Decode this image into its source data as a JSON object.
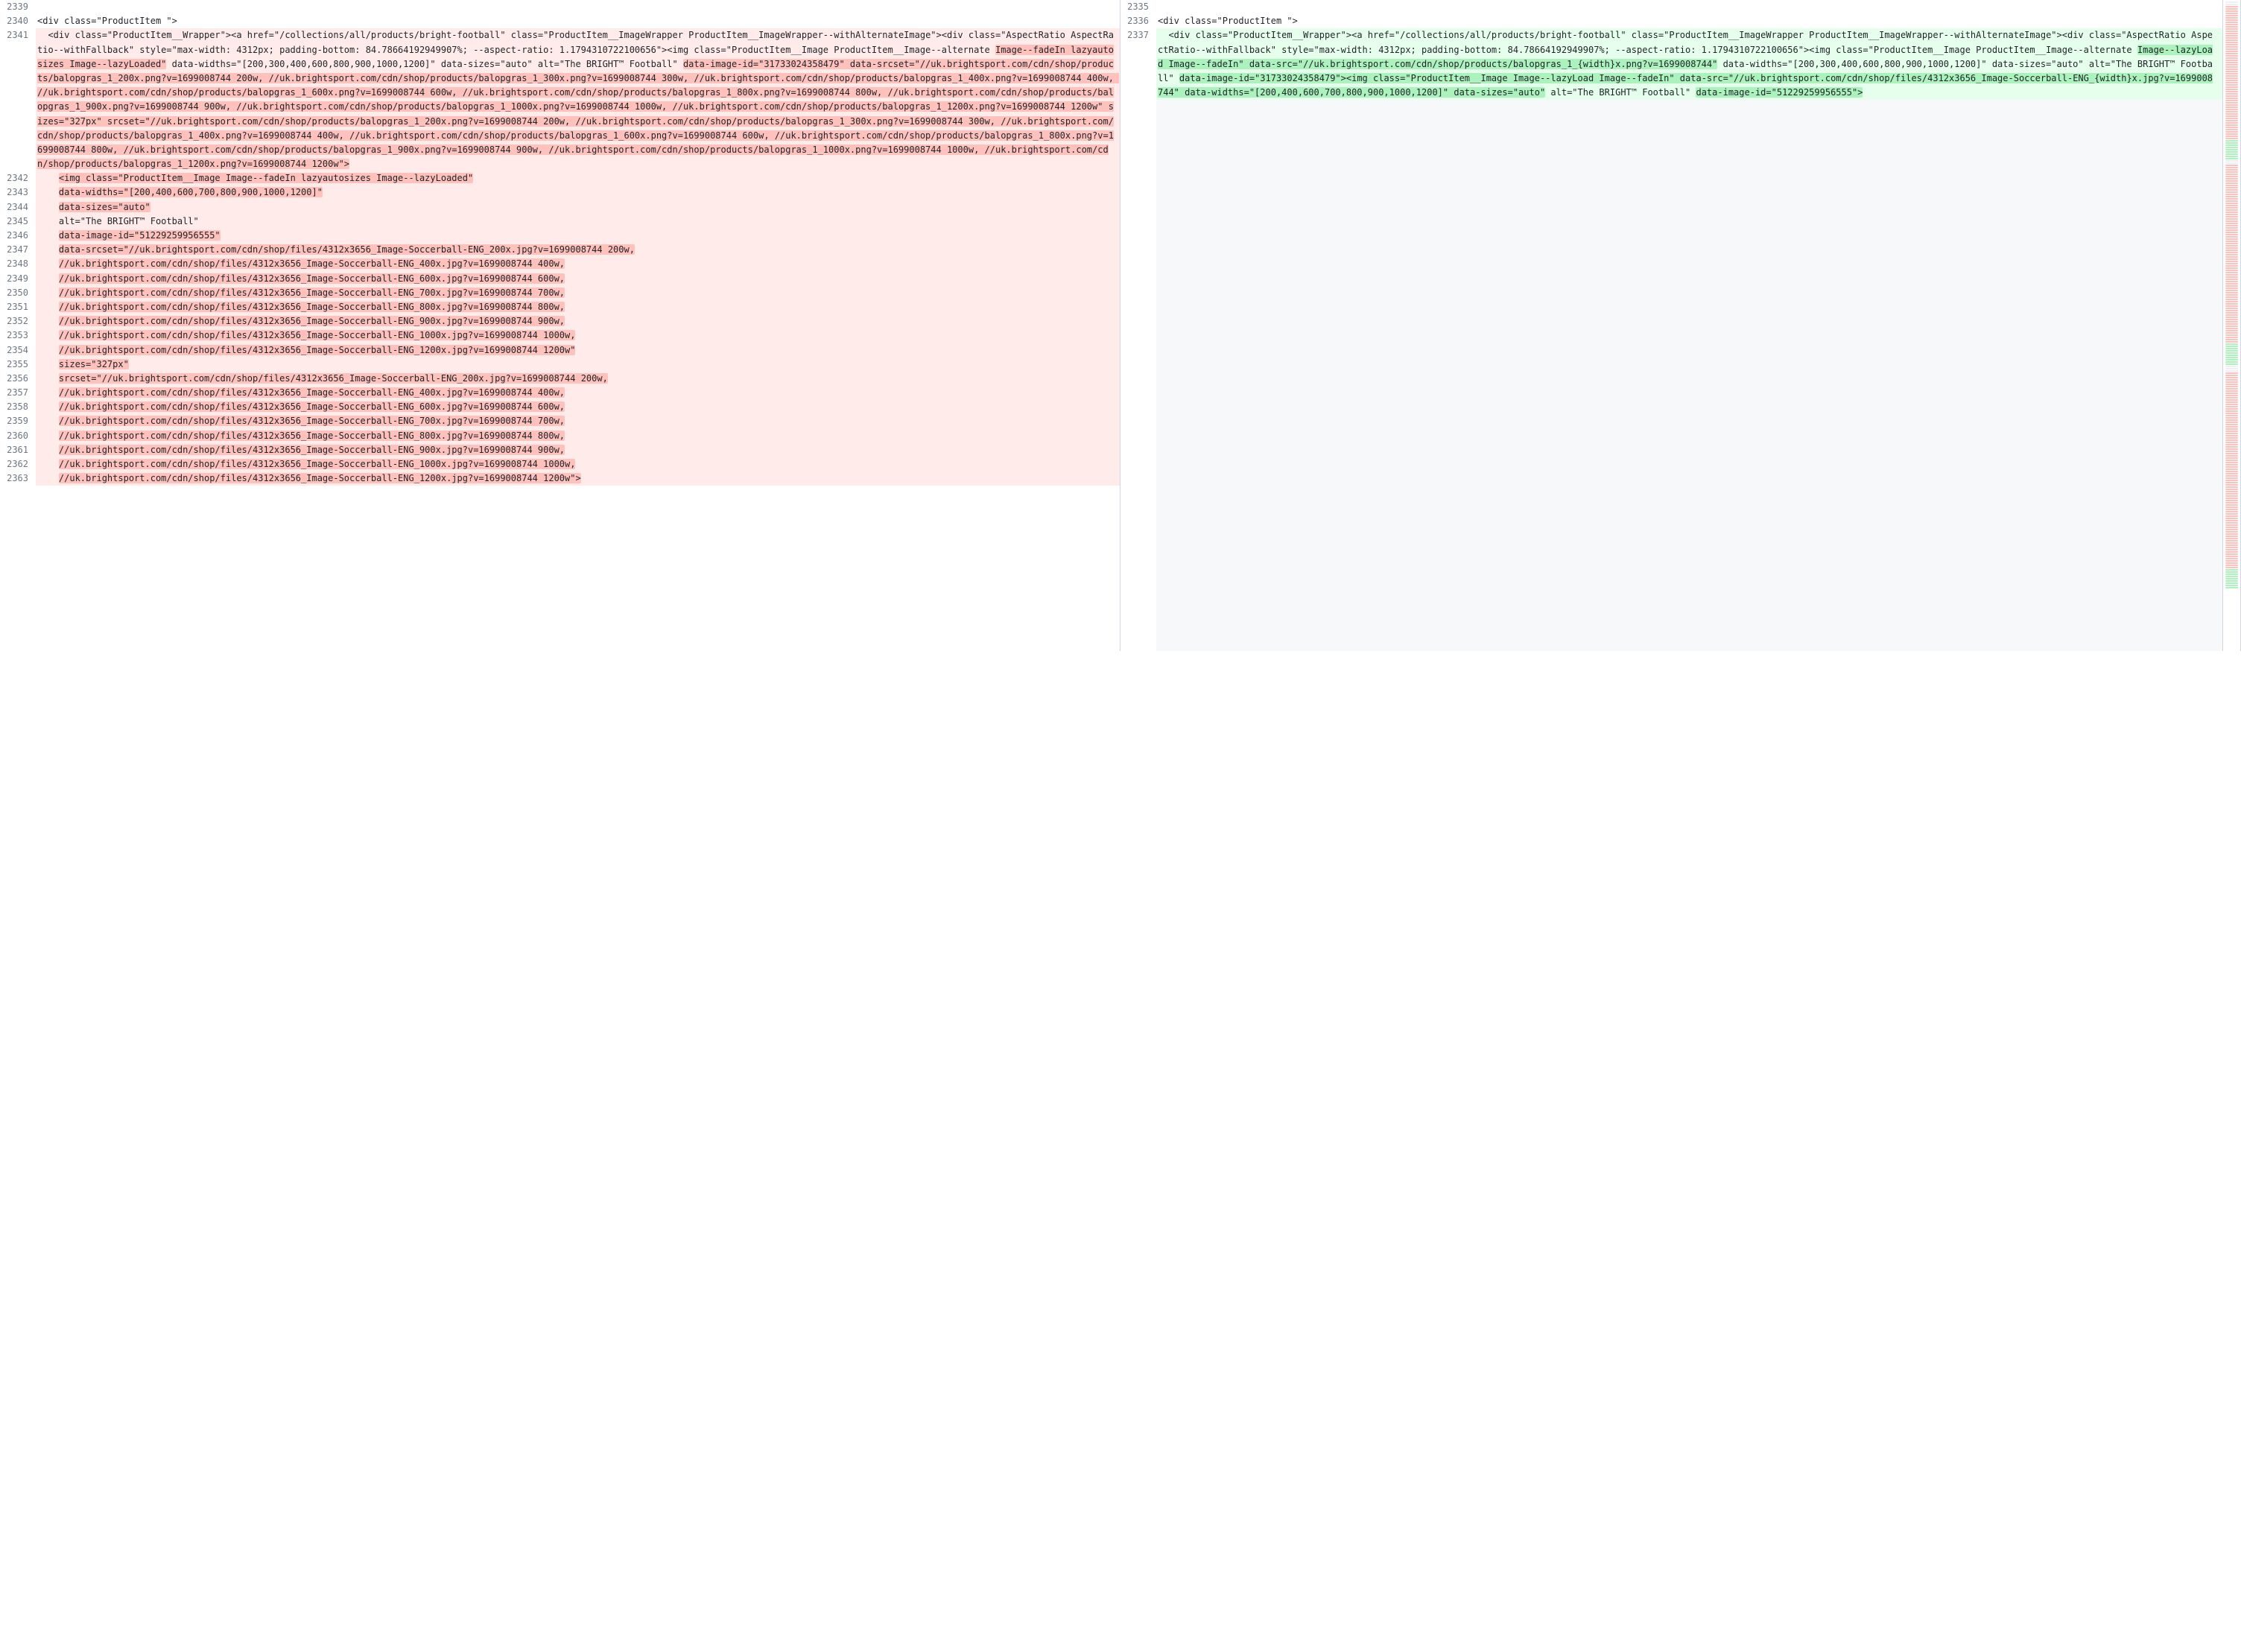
{
  "left": [
    {
      "n": "2339",
      "kind": "ctx",
      "segs": [
        {
          "t": ""
        }
      ]
    },
    {
      "n": "2340",
      "kind": "ctx",
      "segs": [
        {
          "t": "<div class=\"ProductItem \">"
        }
      ]
    },
    {
      "n": "2341",
      "kind": "del",
      "segs": [
        {
          "t": "  <div class=\"ProductItem__Wrapper\"><a href=\"/collections/all/products/bright-football\" class=\"ProductItem__ImageWrapper ProductItem__ImageWrapper--withAlternateImage\"><div class=\"AspectRatio AspectRatio--withFallback\" style=\"max-width: 4312px; padding-bottom: 84.78664192949907%; --aspect-ratio: 1.1794310722100656\"><img class=\"ProductItem__Image ProductItem__Image--alternate "
        },
        {
          "t": "Image--fadeIn lazyautosizes Image--lazyLoaded\"",
          "h": true
        },
        {
          "t": " data-widths=\"[200,300,400,600,800,900,1000,1200]\" data-sizes=\"auto\" alt=\"The BRIGHT™ Football\" "
        },
        {
          "t": "data-image-id=\"31733024358479\" data-srcset=\"//uk.brightsport.com/cdn/shop/products/balopgras_1_200x.png?v=1699008744 200w, //uk.brightsport.com/cdn/shop/products/balopgras_1_300x.png?v=1699008744 300w, //uk.brightsport.com/cdn/shop/products/balopgras_1_400x.png?v=1699008744 400w, //uk.brightsport.com/cdn/shop/products/balopgras_1_600x.png?v=1699008744 600w, //uk.brightsport.com/cdn/shop/products/balopgras_1_800x.png?v=1699008744 800w, //uk.brightsport.com/cdn/shop/products/balopgras_1_900x.png?v=1699008744 900w, //uk.brightsport.com/cdn/shop/products/balopgras_1_1000x.png?v=1699008744 1000w, //uk.brightsport.com/cdn/shop/products/balopgras_1_1200x.png?v=1699008744 1200w\" sizes=\"327px\" srcset=\"//uk.brightsport.com/cdn/shop/products/balopgras_1_200x.png?v=1699008744 200w, //uk.brightsport.com/cdn/shop/products/balopgras_1_300x.png?v=1699008744 300w, //uk.brightsport.com/cdn/shop/products/balopgras_1_400x.png?v=1699008744 400w, //uk.brightsport.com/cdn/shop/products/balopgras_1_600x.png?v=1699008744 600w, //uk.brightsport.com/cdn/shop/products/balopgras_1_800x.png?v=1699008744 800w, //uk.brightsport.com/cdn/shop/products/balopgras_1_900x.png?v=1699008744 900w, //uk.brightsport.com/cdn/shop/products/balopgras_1_1000x.png?v=1699008744 1000w, //uk.brightsport.com/cdn/shop/products/balopgras_1_1200x.png?v=1699008744 1200w\">",
          "h": true
        }
      ]
    },
    {
      "n": "2342",
      "kind": "del",
      "segs": [
        {
          "t": "    "
        },
        {
          "t": "<img class=\"ProductItem__Image Image--fadeIn lazyautosizes Image--lazyLoaded\"",
          "h": true
        }
      ]
    },
    {
      "n": "2343",
      "kind": "del",
      "segs": [
        {
          "t": "    "
        },
        {
          "t": "data-widths=\"[200,400,600,700,800,900,1000,1200]\"",
          "h": true
        }
      ]
    },
    {
      "n": "2344",
      "kind": "del",
      "segs": [
        {
          "t": "    "
        },
        {
          "t": "data-sizes=\"auto\"",
          "h": true
        }
      ]
    },
    {
      "n": "2345",
      "kind": "del",
      "segs": [
        {
          "t": "    alt=\"The BRIGHT™ Football\""
        }
      ]
    },
    {
      "n": "2346",
      "kind": "del",
      "segs": [
        {
          "t": "    "
        },
        {
          "t": "data-image-id=\"51229259956555\"",
          "h": true
        }
      ]
    },
    {
      "n": "2347",
      "kind": "del",
      "segs": [
        {
          "t": "    "
        },
        {
          "t": "data-srcset=\"//uk.brightsport.com/cdn/shop/files/4312x3656_Image-Soccerball-ENG_200x.jpg?v=1699008744 200w,",
          "h": true
        }
      ]
    },
    {
      "n": "2348",
      "kind": "del",
      "segs": [
        {
          "t": "    "
        },
        {
          "t": "//uk.brightsport.com/cdn/shop/files/4312x3656_Image-Soccerball-ENG_400x.jpg?v=1699008744 400w,",
          "h": true
        }
      ]
    },
    {
      "n": "2349",
      "kind": "del",
      "segs": [
        {
          "t": "    "
        },
        {
          "t": "//uk.brightsport.com/cdn/shop/files/4312x3656_Image-Soccerball-ENG_600x.jpg?v=1699008744 600w,",
          "h": true
        }
      ]
    },
    {
      "n": "2350",
      "kind": "del",
      "segs": [
        {
          "t": "    "
        },
        {
          "t": "//uk.brightsport.com/cdn/shop/files/4312x3656_Image-Soccerball-ENG_700x.jpg?v=1699008744 700w,",
          "h": true
        }
      ]
    },
    {
      "n": "2351",
      "kind": "del",
      "segs": [
        {
          "t": "    "
        },
        {
          "t": "//uk.brightsport.com/cdn/shop/files/4312x3656_Image-Soccerball-ENG_800x.jpg?v=1699008744 800w,",
          "h": true
        }
      ]
    },
    {
      "n": "2352",
      "kind": "del",
      "segs": [
        {
          "t": "    "
        },
        {
          "t": "//uk.brightsport.com/cdn/shop/files/4312x3656_Image-Soccerball-ENG_900x.jpg?v=1699008744 900w,",
          "h": true
        }
      ]
    },
    {
      "n": "2353",
      "kind": "del",
      "segs": [
        {
          "t": "    "
        },
        {
          "t": "//uk.brightsport.com/cdn/shop/files/4312x3656_Image-Soccerball-ENG_1000x.jpg?v=1699008744 1000w,",
          "h": true
        }
      ]
    },
    {
      "n": "2354",
      "kind": "del",
      "segs": [
        {
          "t": "    "
        },
        {
          "t": "//uk.brightsport.com/cdn/shop/files/4312x3656_Image-Soccerball-ENG_1200x.jpg?v=1699008744 1200w\"",
          "h": true
        }
      ]
    },
    {
      "n": "2355",
      "kind": "del",
      "segs": [
        {
          "t": "    "
        },
        {
          "t": "sizes=\"327px\"",
          "h": true
        }
      ]
    },
    {
      "n": "2356",
      "kind": "del",
      "segs": [
        {
          "t": "    "
        },
        {
          "t": "srcset=\"//uk.brightsport.com/cdn/shop/files/4312x3656_Image-Soccerball-ENG_200x.jpg?v=1699008744 200w,",
          "h": true
        }
      ]
    },
    {
      "n": "2357",
      "kind": "del",
      "segs": [
        {
          "t": "    "
        },
        {
          "t": "//uk.brightsport.com/cdn/shop/files/4312x3656_Image-Soccerball-ENG_400x.jpg?v=1699008744 400w,",
          "h": true
        }
      ]
    },
    {
      "n": "2358",
      "kind": "del",
      "segs": [
        {
          "t": "    "
        },
        {
          "t": "//uk.brightsport.com/cdn/shop/files/4312x3656_Image-Soccerball-ENG_600x.jpg?v=1699008744 600w,",
          "h": true
        }
      ]
    },
    {
      "n": "2359",
      "kind": "del",
      "segs": [
        {
          "t": "    "
        },
        {
          "t": "//uk.brightsport.com/cdn/shop/files/4312x3656_Image-Soccerball-ENG_700x.jpg?v=1699008744 700w,",
          "h": true
        }
      ]
    },
    {
      "n": "2360",
      "kind": "del",
      "segs": [
        {
          "t": "    "
        },
        {
          "t": "//uk.brightsport.com/cdn/shop/files/4312x3656_Image-Soccerball-ENG_800x.jpg?v=1699008744 800w,",
          "h": true
        }
      ]
    },
    {
      "n": "2361",
      "kind": "del",
      "segs": [
        {
          "t": "    "
        },
        {
          "t": "//uk.brightsport.com/cdn/shop/files/4312x3656_Image-Soccerball-ENG_900x.jpg?v=1699008744 900w,",
          "h": true
        }
      ]
    },
    {
      "n": "2362",
      "kind": "del",
      "segs": [
        {
          "t": "    "
        },
        {
          "t": "//uk.brightsport.com/cdn/shop/files/4312x3656_Image-Soccerball-ENG_1000x.jpg?v=1699008744 1000w,",
          "h": true
        }
      ]
    },
    {
      "n": "2363",
      "kind": "del",
      "segs": [
        {
          "t": "    "
        },
        {
          "t": "//uk.brightsport.com/cdn/shop/files/4312x3656_Image-Soccerball-ENG_1200x.jpg?v=1699008744 1200w\">",
          "h": true
        }
      ]
    }
  ],
  "right": [
    {
      "n": "2335",
      "kind": "ctx",
      "segs": [
        {
          "t": ""
        }
      ]
    },
    {
      "n": "2336",
      "kind": "ctx",
      "segs": [
        {
          "t": "<div class=\"ProductItem \">"
        }
      ]
    },
    {
      "n": "2337",
      "kind": "add",
      "segs": [
        {
          "t": "  <div class=\"ProductItem__Wrapper\"><a href=\"/collections/all/products/bright-football\" class=\"ProductItem__ImageWrapper ProductItem__ImageWrapper--withAlternateImage\"><div class=\"AspectRatio AspectRatio--withFallback\" style=\"max-width: 4312px; padding-bottom: 84.78664192949907%; --aspect-ratio: 1.1794310722100656\"><img class=\"ProductItem__Image ProductItem__Image--alternate "
        },
        {
          "t": "Image--lazyLoad Image--fadeIn\" data-src=\"//uk.brightsport.com/cdn/shop/products/balopgras_1_{width}x.png?v=1699008744\"",
          "h": true
        },
        {
          "t": " data-widths=\"[200,300,400,600,800,900,1000,1200]\" data-sizes=\"auto\" alt=\"The BRIGHT™ Football\" "
        },
        {
          "t": "data-image-id=\"31733024358479\"><img class=\"ProductItem__Image Image--lazyLoad Image--fadeIn\" data-src=\"//uk.brightsport.com/cdn/shop/files/4312x3656_Image-Soccerball-ENG_{width}x.jpg?v=1699008744\" data-widths=\"[200,400,600,700,800,900,1000,1200]\" data-sizes=\"auto\"",
          "h": true
        },
        {
          "t": " alt=\"The BRIGHT™ Football\" "
        },
        {
          "t": "data-image-id=\"51229259956555\">",
          "h": true
        }
      ]
    }
  ],
  "minimap": [
    "ctx",
    "ctx",
    "del",
    "del",
    "del",
    "del",
    "del",
    "del",
    "del",
    "del",
    "del",
    "del",
    "del",
    "del",
    "del",
    "del",
    "del",
    "del",
    "del",
    "del",
    "del",
    "del",
    "del",
    "del",
    "del",
    "del",
    "del",
    "del",
    "del",
    "del",
    "del",
    "del",
    "del",
    "del",
    "del",
    "del",
    "del",
    "del",
    "del",
    "del",
    "del",
    "del",
    "del",
    "del",
    "del",
    "del",
    "del",
    "del",
    "del",
    "del",
    "del",
    "del",
    "del",
    "del",
    "del",
    "del",
    "del",
    "del",
    "del",
    "del",
    "del",
    "del",
    "add",
    "add",
    "add",
    "add",
    "add",
    "add",
    "add",
    "add",
    "add",
    "ctx",
    "ctx",
    "del",
    "del",
    "del",
    "del",
    "del",
    "del",
    "del",
    "del",
    "del",
    "del",
    "del",
    "del",
    "del",
    "del",
    "del",
    "del",
    "del",
    "del",
    "del",
    "del",
    "del",
    "del",
    "del",
    "del",
    "del",
    "del",
    "del",
    "del",
    "del",
    "del",
    "del",
    "del",
    "del",
    "del",
    "del",
    "del",
    "del",
    "del",
    "del",
    "del",
    "del",
    "del",
    "del",
    "del",
    "del",
    "del",
    "del",
    "del",
    "del",
    "del",
    "del",
    "del",
    "del",
    "del",
    "del",
    "del",
    "del",
    "del",
    "del",
    "del",
    "del",
    "del",
    "del",
    "del",
    "del",
    "del",
    "del",
    "del",
    "del",
    "del",
    "del",
    "del",
    "del",
    "del",
    "del",
    "del",
    "del",
    "del",
    "del",
    "del",
    "add",
    "add",
    "add",
    "add",
    "add",
    "add",
    "add",
    "add",
    "add",
    "add",
    "ctx",
    "ctx",
    "ctx",
    "del",
    "del",
    "del",
    "del",
    "del",
    "del",
    "del",
    "del",
    "del",
    "del",
    "del",
    "del",
    "del",
    "del",
    "del",
    "del",
    "del",
    "del",
    "del",
    "del",
    "del",
    "del",
    "del",
    "del",
    "del",
    "del",
    "del",
    "del",
    "del",
    "del",
    "del",
    "del",
    "del",
    "del",
    "del",
    "del",
    "del",
    "del",
    "del",
    "del",
    "del",
    "del",
    "del",
    "del",
    "del",
    "del",
    "del",
    "del",
    "del",
    "del",
    "del",
    "del",
    "del",
    "del",
    "del",
    "del",
    "del",
    "del",
    "del",
    "del",
    "del",
    "del",
    "del",
    "del",
    "del",
    "del",
    "del",
    "del",
    "del",
    "del",
    "del",
    "del",
    "del",
    "del",
    "del",
    "del",
    "del",
    "del",
    "del",
    "del",
    "del",
    "del",
    "del",
    "del",
    "del",
    "del",
    "del",
    "del",
    "add",
    "add",
    "add",
    "add",
    "add",
    "add",
    "add",
    "add",
    "add"
  ]
}
